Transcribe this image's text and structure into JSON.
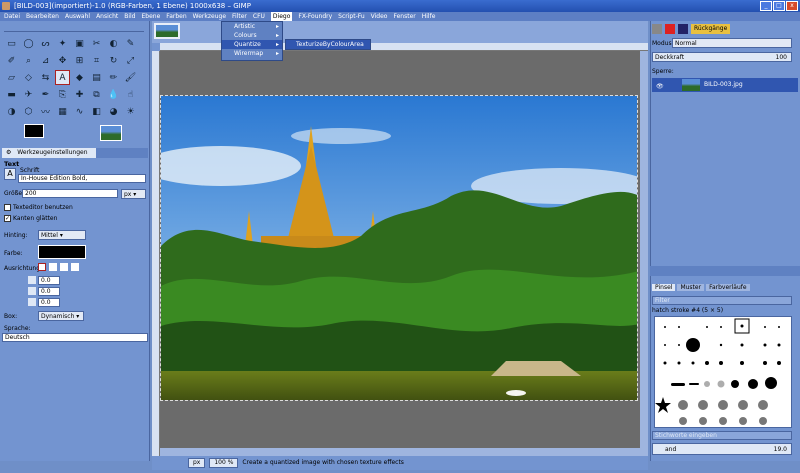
{
  "window": {
    "title": "[BILD-003](importiert)-1.0 (RGB-Farben, 1 Ebene) 1000x638 – GIMP",
    "buttons": [
      "_",
      "□",
      "x"
    ]
  },
  "menubar": [
    "Datei",
    "Bearbeiten",
    "Auswahl",
    "Ansicht",
    "Bild",
    "Ebene",
    "Farben",
    "Werkzeuge",
    "Filter",
    "CFU",
    "Diego",
    "FX-Foundry",
    "Script-Fu",
    "Video",
    "Fenster",
    "Hilfe"
  ],
  "diego_menu": {
    "items": [
      "Artistic",
      "Colours",
      "Quantize",
      "Wirermap"
    ],
    "highlighted": "Quantize",
    "arrow": "▸"
  },
  "submenu": {
    "item": "TexturizeByColourArea"
  },
  "tool_options": {
    "tab_label": "Werkzeugeinstellungen",
    "section": "Text",
    "font_label": "Schrift",
    "font_value": "In-House Edition Bold,",
    "size_label": "Größe:",
    "size_value": "200",
    "size_unit": "px",
    "editor_label": "Texteditor benutzen",
    "antialias_label": "Kanten glätten",
    "hinting_label": "Hinting:",
    "hinting_value": "Mittel",
    "color_label": "Farbe:",
    "justify_label": "Ausrichtung",
    "indent_values": [
      "0.0",
      "0.0",
      "0.0"
    ],
    "box_label": "Box:",
    "box_value": "Dynamisch",
    "lang_label": "Sprache:",
    "lang_value": "Deutsch"
  },
  "layers": {
    "undo_tab": "Rückgänge",
    "mode_label": "Modus:",
    "mode_value": "Normal",
    "opacity_label": "Deckkraft",
    "opacity_value": "100",
    "lock_label": "Sperre:",
    "layer_name": "BILD-003.jpg"
  },
  "brushes": {
    "tabs": [
      "Pinsel",
      "Muster",
      "Farbverläufe"
    ],
    "filter_placeholder": "Filter",
    "current": "hatch stroke #4 (5 × 5)",
    "tag_placeholder": "Stichworte eingeben",
    "spacing_label": "and",
    "spacing_value": "19.0"
  },
  "status": {
    "unit": "px",
    "zoom": "100 %",
    "message": "Create a quantized image with chosen texture effects"
  }
}
